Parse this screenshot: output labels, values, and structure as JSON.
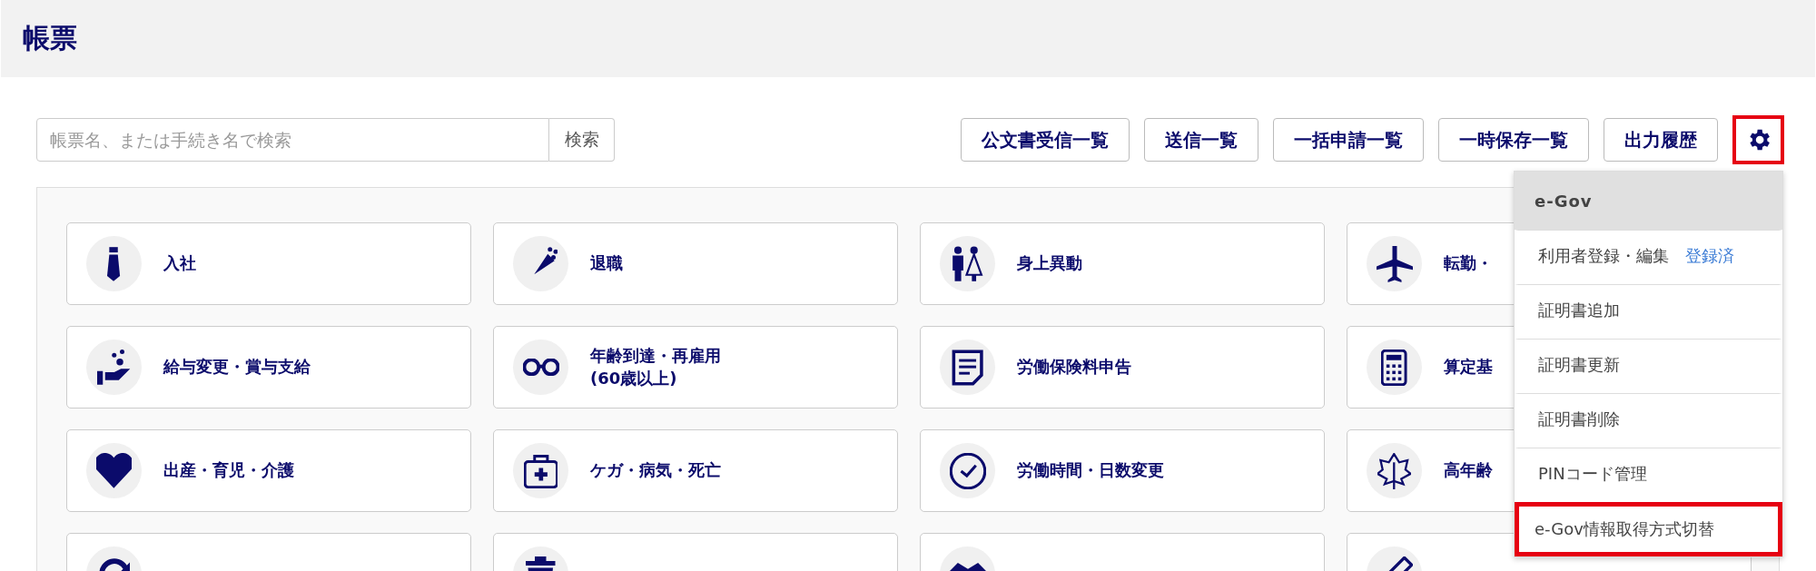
{
  "header": {
    "title": "帳票"
  },
  "search": {
    "placeholder": "帳票名、または手続き名で検索",
    "button": "検索"
  },
  "toolbar": [
    {
      "label": "公文書受信一覧"
    },
    {
      "label": "送信一覧"
    },
    {
      "label": "一括申請一覧"
    },
    {
      "label": "一時保存一覧"
    },
    {
      "label": "出力履歴"
    }
  ],
  "settings_button": {
    "highlighted": true
  },
  "categories": [
    {
      "kind": "card",
      "label": "入社"
    },
    {
      "kind": "card",
      "label": "退職"
    },
    {
      "kind": "card",
      "label": "身上異動"
    },
    {
      "kind": "card",
      "label": "転勤・"
    },
    {
      "kind": "card",
      "label": "給与変更・賞与支給"
    },
    {
      "kind": "card",
      "label": "年齢到達・再雇用\n(60歳以上)"
    },
    {
      "kind": "card",
      "label": "労働保険料申告"
    },
    {
      "kind": "card",
      "label": "算定基"
    },
    {
      "kind": "card",
      "label": "出産・育児・介護"
    },
    {
      "kind": "card",
      "label": "ケガ・病気・死亡"
    },
    {
      "kind": "card",
      "label": "労働時間・日数変更"
    },
    {
      "kind": "card",
      "label": "高年齢"
    },
    {
      "kind": "cut"
    },
    {
      "kind": "cut"
    },
    {
      "kind": "cut"
    },
    {
      "kind": "cut"
    }
  ],
  "settings_menu": {
    "header": "e-Gov",
    "items": [
      {
        "label": "利用者登録・編集",
        "badge": "登録済",
        "highlighted": false
      },
      {
        "label": "証明書追加",
        "highlighted": false
      },
      {
        "label": "証明書更新",
        "highlighted": false
      },
      {
        "label": "証明書削除",
        "highlighted": false
      },
      {
        "label": "PINコード管理",
        "highlighted": false
      },
      {
        "label": "e-Gov情報取得方式切替",
        "highlighted": true
      }
    ]
  }
}
